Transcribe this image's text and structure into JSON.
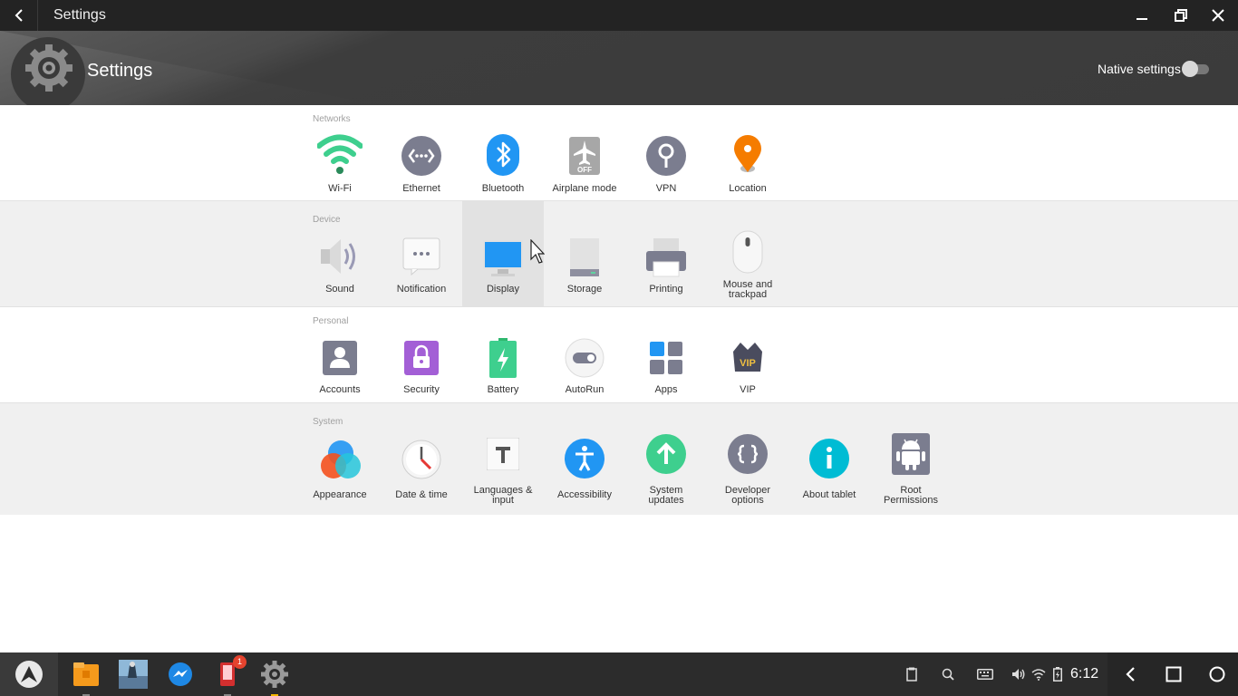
{
  "window": {
    "title": "Settings"
  },
  "header": {
    "title": "Settings",
    "native_label": "Native settings",
    "native_on": false
  },
  "sections": {
    "networks": {
      "label": "Networks",
      "items": [
        "Wi-Fi",
        "Ethernet",
        "Bluetooth",
        "Airplane mode",
        "VPN",
        "Location"
      ]
    },
    "device": {
      "label": "Device",
      "items": [
        "Sound",
        "Notification",
        "Display",
        "Storage",
        "Printing",
        "Mouse and trackpad"
      ]
    },
    "personal": {
      "label": "Personal",
      "items": [
        "Accounts",
        "Security",
        "Battery",
        "AutoRun",
        "Apps",
        "VIP"
      ]
    },
    "system": {
      "label": "System",
      "items": [
        "Appearance",
        "Date & time",
        "Languages & input",
        "Accessibility",
        "System updates",
        "Developer options",
        "About tablet",
        "Root Permissions"
      ]
    }
  },
  "selected_item": "Display",
  "taskbar": {
    "clock": "6:12",
    "badge_count": "1",
    "apps": [
      "start-menu-icon",
      "file-manager-icon",
      "game-app-icon",
      "messenger-icon",
      "phone-app-icon",
      "settings-icon"
    ]
  },
  "icons": {
    "airplane_off": "OFF",
    "vip": "VIP"
  },
  "colors": {
    "titlebar": "#232323",
    "header": "#3d3d3d",
    "gray_section": "#f0f0f0",
    "taskbar": "#2c2c2c"
  }
}
